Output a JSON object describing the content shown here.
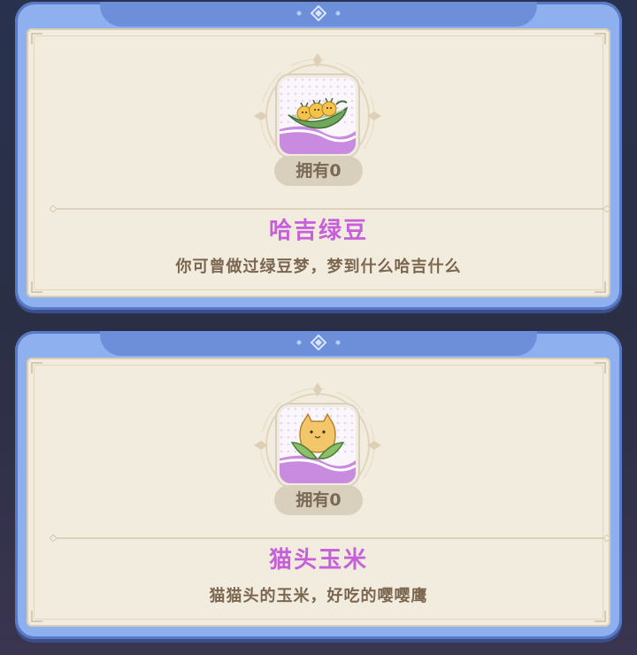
{
  "items": [
    {
      "owned_label": "拥有0",
      "name": "哈吉绿豆",
      "description": "你可曾做过绿豆梦，梦到什么哈吉什么",
      "icon": "pea-pod-chicks-icon"
    },
    {
      "owned_label": "拥有0",
      "name": "猫头玉米",
      "description": "猫猫头的玉米，好吃的嘤嘤鹰",
      "icon": "cat-head-corn-icon"
    }
  ],
  "colors": {
    "card_border": "#8fb0ee",
    "panel": "#f2ecdf",
    "name": "#c65fd9",
    "description": "#7b6650",
    "owned_badge": "#d9cfbd"
  }
}
